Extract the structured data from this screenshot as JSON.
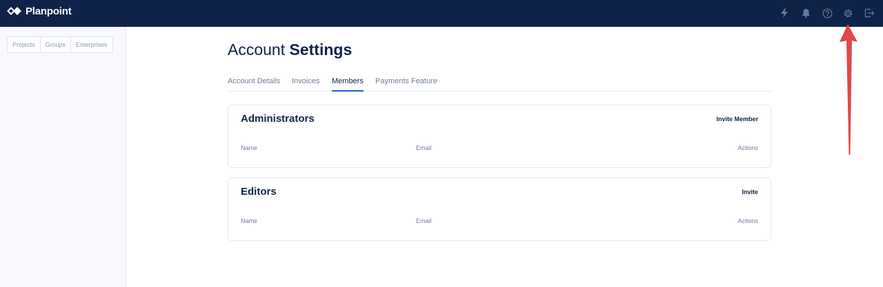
{
  "app": {
    "brand": "Planpoint"
  },
  "header": {
    "icons": [
      {
        "name": "lightning-icon"
      },
      {
        "name": "bell-icon"
      },
      {
        "name": "help-icon"
      },
      {
        "name": "settings-icon"
      },
      {
        "name": "logout-icon"
      }
    ],
    "color": "#0f2349"
  },
  "sidebar": {
    "tabs": [
      {
        "label": "Projects"
      },
      {
        "label": "Groups"
      },
      {
        "label": "Enterprises"
      }
    ]
  },
  "page": {
    "title_light": "Account",
    "title_bold": "Settings",
    "tabs": [
      {
        "label": "Account Details"
      },
      {
        "label": "Invoices"
      },
      {
        "label": "Members"
      },
      {
        "label": "Payments Feature"
      }
    ],
    "active_tab": "Members",
    "accent": "#1f5bd6"
  },
  "sections": [
    {
      "title": "Administrators",
      "action": "Invite Member",
      "columns": [
        "Name",
        "Email",
        "Actions"
      ]
    },
    {
      "title": "Editors",
      "action": "Invite",
      "columns": [
        "Name",
        "Email",
        "Actions"
      ]
    }
  ],
  "annotation": {
    "color": "#e04848",
    "points_to": "settings-icon"
  }
}
